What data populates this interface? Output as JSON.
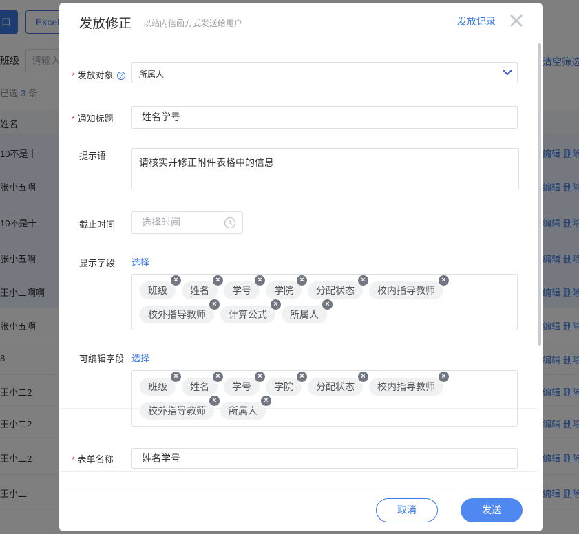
{
  "background": {
    "left_button": "口",
    "excel_button": "Excel",
    "class_label": "班级",
    "input_placeholder": "请输入",
    "clear_filter": "清空筛选",
    "selected_prefix": "已选",
    "selected_count": "3",
    "selected_suffix": "条",
    "name_header": "姓名",
    "edit_label": "编辑",
    "delete_label": "删除",
    "rows": [
      "10不是十",
      "张小五啊",
      "10不是十",
      "张小五啊",
      "王小二啊啊",
      "张小五啊",
      "8",
      "王小二2",
      "王小二2",
      "王小二2",
      "王小二"
    ]
  },
  "dialog": {
    "title": "发放修正",
    "subtitle": "以站内信函方式发送给用户",
    "record_link": "发放记录",
    "close_icon": "close-icon",
    "fields": {
      "target_label": "发放对象",
      "target_value": "所属人",
      "title_label": "通知标题",
      "title_value": "姓名学号",
      "hint_label": "提示语",
      "hint_value": "请核实并修正附件表格中的信息",
      "deadline_label": "截止时间",
      "deadline_placeholder": "选择时间",
      "display_label": "显示字段",
      "display_select": "选择",
      "display_tags": [
        "班级",
        "姓名",
        "学号",
        "学院",
        "分配状态",
        "校内指导教师",
        "校外指导教师",
        "计算公式",
        "所属人"
      ],
      "editable_label": "可编辑字段",
      "editable_select": "选择",
      "editable_tags": [
        "班级",
        "姓名",
        "学号",
        "学院",
        "分配状态",
        "校内指导教师",
        "校外指导教师",
        "所属人"
      ],
      "form_name_label": "表单名称",
      "form_name_value": "姓名学号"
    },
    "cancel_button": "取消",
    "send_button": "发送"
  },
  "colors": {
    "accent": "#3a7be5",
    "send_button": "#4f88f0",
    "required": "#f04134",
    "tag_bg": "#f0f1f3",
    "mask": "rgba(0,0,0,0.5)"
  }
}
